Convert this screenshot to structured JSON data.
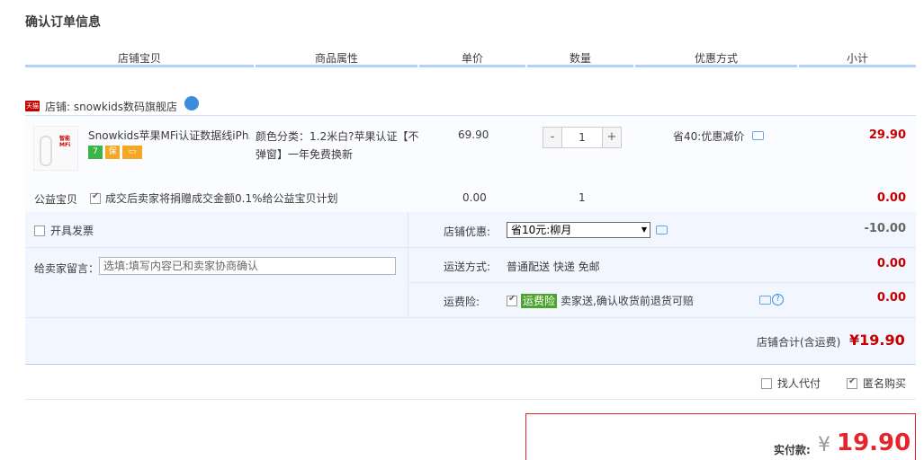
{
  "page_title": "确认订单信息",
  "headers": [
    "店铺宝贝",
    "商品属性",
    "单价",
    "数量",
    "优惠方式",
    "小计"
  ],
  "shop": {
    "badge": "天猫",
    "label": "店铺: snowkids数码旗舰店"
  },
  "item": {
    "thumb_text": "智能 MFi",
    "title": "Snowkids苹果MFi认证数据线iPh...",
    "service_icons": [
      {
        "text": "7",
        "color": "#3bb54a"
      },
      {
        "text": "保",
        "color": "#f5a623"
      },
      {
        "text": "▭",
        "color": "#f5a623"
      }
    ],
    "property": "颜色分类：1.2米白?苹果认证【不弹窗】一年免费换新",
    "price": "69.90",
    "quantity": "1",
    "qty_minus": "-",
    "qty_plus": "+",
    "promo": "省40:优惠减价",
    "subtotal": "29.90"
  },
  "charity": {
    "label": "公益宝贝",
    "desc": "成交后卖家将捐赠成交金额0.1%给公益宝贝计划",
    "price": "0.00",
    "quantity": "1",
    "subtotal": "0.00"
  },
  "options": {
    "invoice_label": "开具发票",
    "message_label": "给卖家留言：",
    "message_placeholder": "选填:填写内容已和卖家协商确认",
    "shop_discount_label": "店铺优惠:",
    "shop_discount_value": "省10元:柳月",
    "shop_discount_amount": "-10.00",
    "shipping_label": "运送方式:",
    "shipping_value": "普通配送 快递 免邮",
    "shipping_amount": "0.00",
    "insurance_label": "运费险:",
    "insurance_tag": "运费险",
    "insurance_desc": "卖家送,确认收货前退货可赔",
    "insurance_amount": "0.00"
  },
  "shop_total": {
    "label": "店铺合计(含运费)",
    "value": "¥19.90"
  },
  "bottom": {
    "proxy_label": "找人代付",
    "anonymous_label": "匿名购买"
  },
  "payment": {
    "label": "实付款:",
    "currency": "¥",
    "value": "19.90"
  }
}
